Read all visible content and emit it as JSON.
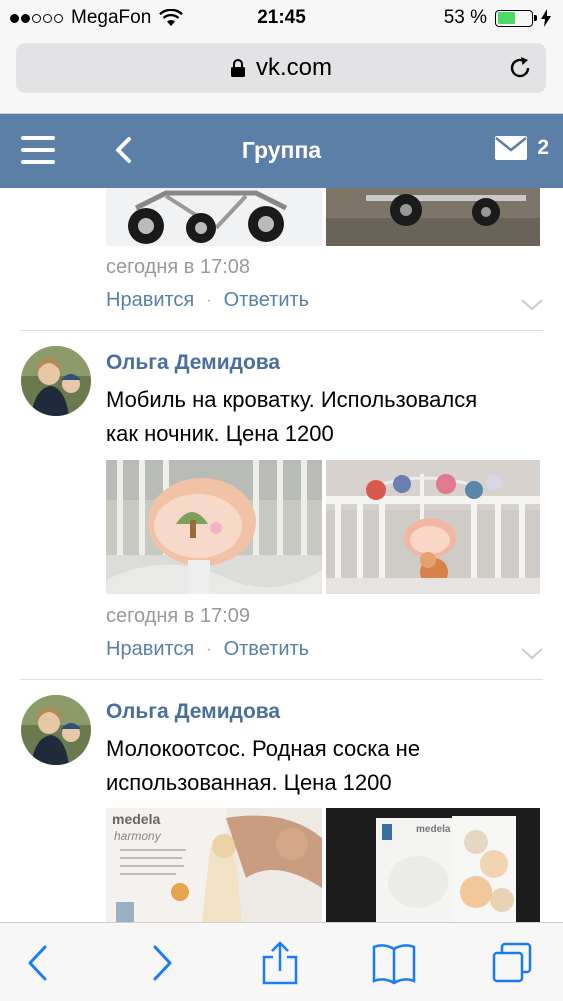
{
  "status": {
    "carrier": "MegaFon",
    "time": "21:45",
    "battery": "53 %",
    "battery_level": 0.53
  },
  "browser": {
    "url": "vk.com"
  },
  "header": {
    "title": "Группа",
    "mail_count": "2"
  },
  "posts": [
    {
      "time": "сегодня в 17:08",
      "like": "Нравится",
      "reply": "Ответить"
    },
    {
      "author": "Ольга Демидова",
      "text_line1": "Мобиль на кроватку. Использовался",
      "text_line2": "как ночник. Цена 1200",
      "time": "сегодня в 17:09",
      "like": "Нравится",
      "reply": "Ответить"
    },
    {
      "author": "Ольга Демидова",
      "text_line1": "Молокоотсос. Родная соска не",
      "text_line2": "использованная. Цена 1200",
      "photo_text_1": "medela",
      "photo_text_2": "harmony",
      "photo_text_3": "medela"
    }
  ],
  "colors": {
    "vk_blue": "#5b7fa6",
    "link": "#5b7fa6",
    "ios_blue": "#1a7cf5"
  }
}
